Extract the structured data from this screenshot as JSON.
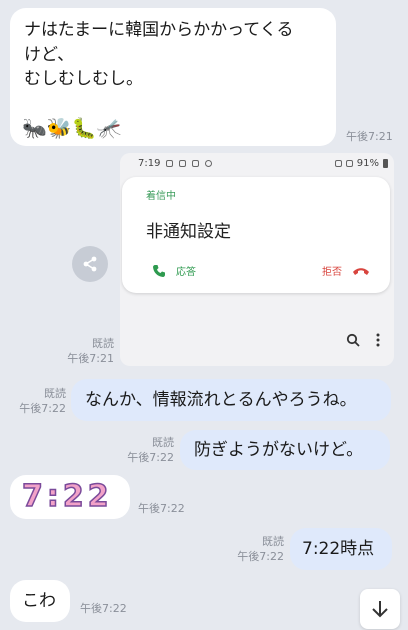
{
  "messages": {
    "m1": {
      "line1": "ナはたまーに韓国からかかってくる",
      "line2": "けど、",
      "line3": "むしむしむし。",
      "emoji": [
        "🐜",
        "🐝",
        "🐛",
        "🦟"
      ],
      "time": "午後7:21"
    },
    "screenshot": {
      "status_time": "7:19",
      "battery": "91%",
      "incoming_label": "着信中",
      "caller": "非通知設定",
      "answer_label": "応答",
      "decline_label": "拒否",
      "read": "既読",
      "time": "午後7:21"
    },
    "m2": {
      "text": "なんか、情報流れとるんやろうね。",
      "read": "既読",
      "time": "午後7:22"
    },
    "m3": {
      "text": "防ぎようがないけど。",
      "read": "既読",
      "time": "午後7:22"
    },
    "m4": {
      "image_text": "7:22",
      "time": "午後7:22"
    },
    "m5": {
      "text": "7:22時点",
      "read": "既読",
      "time": "午後7:22"
    },
    "m6": {
      "text": "こわ",
      "time": "午後7:22"
    }
  },
  "icons": {
    "share": "share-icon",
    "scroll_down": "arrow-down-icon"
  },
  "colors": {
    "background": "#e6e9ef",
    "incoming_bubble": "#ffffff",
    "outgoing_bubble": "#dfe9fb",
    "answer": "#2e9a4f",
    "decline": "#d8453e"
  }
}
